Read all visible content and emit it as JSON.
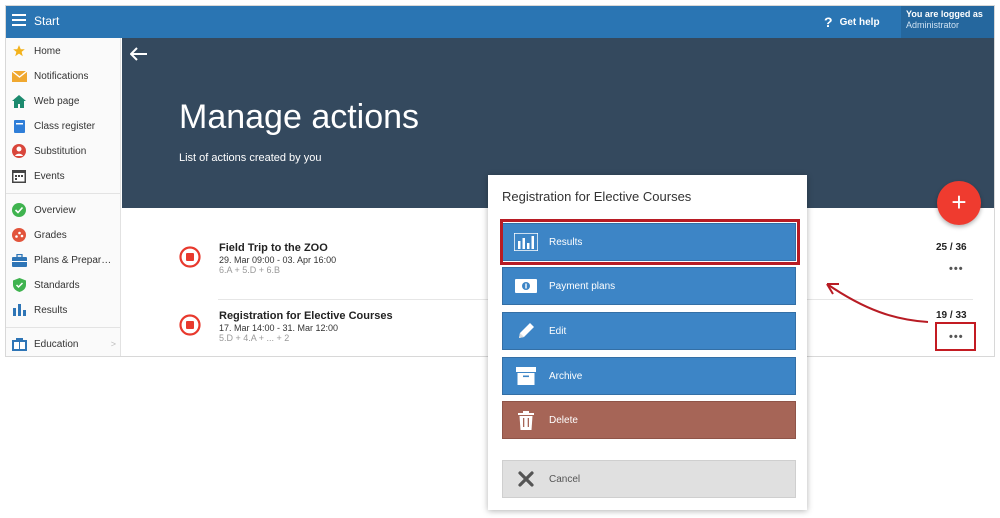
{
  "topbar": {
    "title": "Start",
    "help_label": "Get help",
    "help_glyph": "?",
    "user_line1": "You are logged as",
    "user_line2": "Administrator"
  },
  "sidebar": {
    "items": [
      {
        "label": "Home",
        "icon": "star-icon"
      },
      {
        "label": "Notifications",
        "icon": "envelope-icon"
      },
      {
        "label": "Web page",
        "icon": "house-icon"
      },
      {
        "label": "Class register",
        "icon": "book-icon"
      },
      {
        "label": "Substitution",
        "icon": "person-badge-icon"
      },
      {
        "label": "Events",
        "icon": "calendar-icon"
      },
      {
        "label": "Overview",
        "icon": "check-circle-icon"
      },
      {
        "label": "Grades",
        "icon": "grades-icon"
      },
      {
        "label": "Plans & Preparations",
        "icon": "briefcase-icon"
      },
      {
        "label": "Standards",
        "icon": "shield-check-icon"
      },
      {
        "label": "Results",
        "icon": "bar-chart-icon"
      },
      {
        "label": "Education",
        "icon": "education-icon"
      }
    ],
    "chevron": ">"
  },
  "hero": {
    "title": "Manage actions",
    "subtitle": "List of actions created by you"
  },
  "fab": {
    "label": "+"
  },
  "actions": [
    {
      "title": "Field Trip to the ZOO",
      "date": "29. Mar 09:00 - 03. Apr 16:00",
      "groups": "6.A + 5.D + 6.B",
      "count": "25 / 36",
      "more": "•••"
    },
    {
      "title": "Registration for Elective Courses",
      "date": "17. Mar 14:00 - 31. Mar 12:00",
      "groups": "5.D + 4.A + ... + 2",
      "count": "19 / 33",
      "more": "•••"
    }
  ],
  "modal": {
    "title": "Registration for Elective Courses",
    "buttons": {
      "results": "Results",
      "payment_plans": "Payment plans",
      "edit": "Edit",
      "archive": "Archive",
      "delete": "Delete",
      "cancel": "Cancel"
    }
  },
  "colors": {
    "topbar": "#2a75b3",
    "hero": "#34495e",
    "button_blue": "#3d85c6",
    "button_delete": "#a66557",
    "fab": "#ef3b2f",
    "highlight": "#c31b22"
  }
}
